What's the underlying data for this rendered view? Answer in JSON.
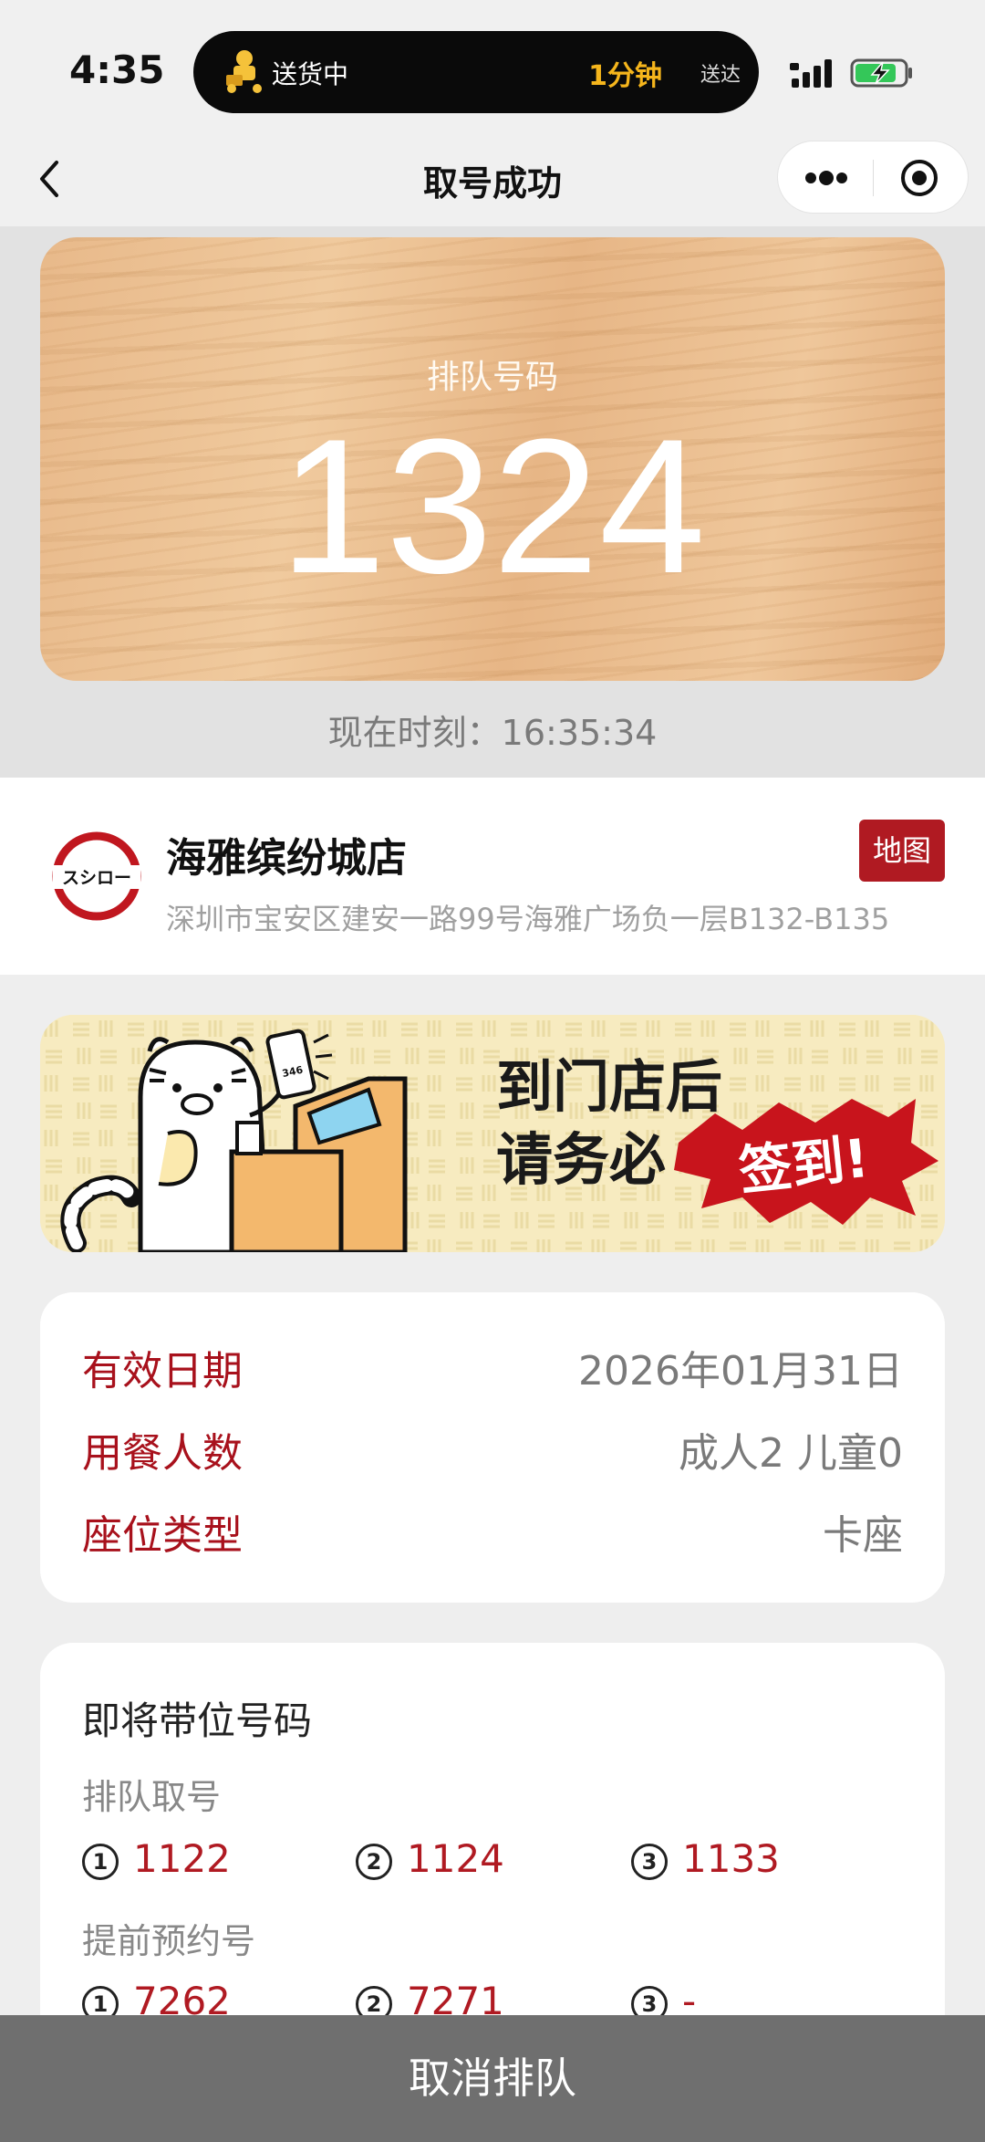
{
  "status_bar": {
    "time": "4:35",
    "island_text": "送货中",
    "island_eta": "1分钟",
    "island_eta_suffix": "送达"
  },
  "nav": {
    "title": "取号成功"
  },
  "hero": {
    "queue_label": "排队号码",
    "queue_number": "1324",
    "current_time": "现在时刻：16:35:34"
  },
  "store": {
    "logo_text": "スシロー",
    "name": "海雅缤纷城店",
    "address": "深圳市宝安区建安一路99号海雅广场负一层B132-B135",
    "map_label": "地图"
  },
  "banner": {
    "line1": "到门店后",
    "line2": "请务必",
    "stamp": "签到!",
    "phone_text": "346"
  },
  "info": {
    "rows": [
      {
        "key": "有效日期",
        "value": "2026年01月31日"
      },
      {
        "key": "用餐人数",
        "value": "成人2 儿童0"
      },
      {
        "key": "座位类型",
        "value": "卡座"
      }
    ]
  },
  "upcoming": {
    "title": "即将带位号码",
    "queue_section": "排队取号",
    "queue_numbers": [
      {
        "index": "1",
        "value": "1122"
      },
      {
        "index": "2",
        "value": "1124"
      },
      {
        "index": "3",
        "value": "1133"
      }
    ],
    "reservation_section": "提前预约号",
    "reservation_numbers": [
      {
        "index": "1",
        "value": "7262"
      },
      {
        "index": "2",
        "value": "7271"
      },
      {
        "index": "3",
        "value": "---"
      }
    ]
  },
  "bottom": {
    "cancel_label": "取消排队"
  },
  "colors": {
    "brand_red": "#b01a22",
    "bottom_bar": "#6f6f6f",
    "eta_yellow": "#f5b51c"
  }
}
